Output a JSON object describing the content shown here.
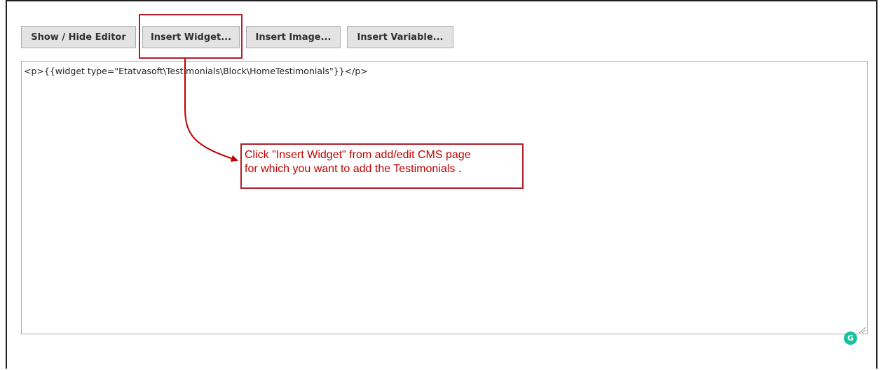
{
  "toolbar": {
    "show_hide_label": "Show / Hide Editor",
    "insert_widget_label": "Insert Widget...",
    "insert_image_label": "Insert Image...",
    "insert_variable_label": "Insert Variable..."
  },
  "editor": {
    "content": "<p>{{widget type=\"Etatvasoft\\Testimonials\\Block\\HomeTestimonials\"}}</p>"
  },
  "callout": {
    "line1": "Click \"Insert Widget\" from add/edit CMS page",
    "line2": "for which you want to add the Testimonials ."
  },
  "grammarly": {
    "letter": "G",
    "color": "#15c39a"
  },
  "colors": {
    "annotation": "#b0202a",
    "button_bg": "#e3e3e3"
  }
}
